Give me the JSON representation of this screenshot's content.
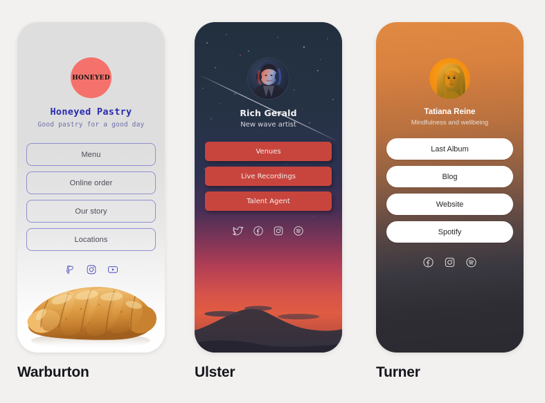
{
  "page": {
    "background_color": "#F2F1EF"
  },
  "cards": [
    {
      "caption": "Warburton",
      "logo_text": "HONEYED",
      "logo_color": "#F4726B",
      "title": "Honeyed Pastry",
      "subtitle": "Good pastry for a good day",
      "title_color": "#2A2AAE",
      "buttons": [
        {
          "label": "Menu"
        },
        {
          "label": "Online order"
        },
        {
          "label": "Our story"
        },
        {
          "label": "Locations"
        }
      ],
      "socials": [
        {
          "name": "paypal-icon"
        },
        {
          "name": "instagram-icon"
        },
        {
          "name": "youtube-icon"
        }
      ],
      "photo": "croissant-photo"
    },
    {
      "caption": "Ulster",
      "avatar": "rich-gerald-avatar",
      "name": "Rich Gerald",
      "role": "New wave artist",
      "button_color": "#C8453E",
      "buttons": [
        {
          "label": "Venues"
        },
        {
          "label": "Live Recordings"
        },
        {
          "label": "Talent Agent"
        }
      ],
      "socials": [
        {
          "name": "twitter-icon"
        },
        {
          "name": "facebook-icon"
        },
        {
          "name": "instagram-icon"
        },
        {
          "name": "spotify-icon"
        }
      ],
      "background": "starry-night-sunset-mountain"
    },
    {
      "caption": "Turner",
      "avatar": "tatiana-reine-avatar",
      "name": "Tatiana Reine",
      "role": "Mindfulness and wellbeing",
      "button_color": "#FFFFFF",
      "buttons": [
        {
          "label": "Last Album"
        },
        {
          "label": "Blog"
        },
        {
          "label": "Website"
        },
        {
          "label": "Spotify"
        }
      ],
      "socials": [
        {
          "name": "facebook-icon"
        },
        {
          "name": "instagram-icon"
        },
        {
          "name": "spotify-icon"
        }
      ],
      "background": "orange-to-dark-gradient"
    }
  ]
}
